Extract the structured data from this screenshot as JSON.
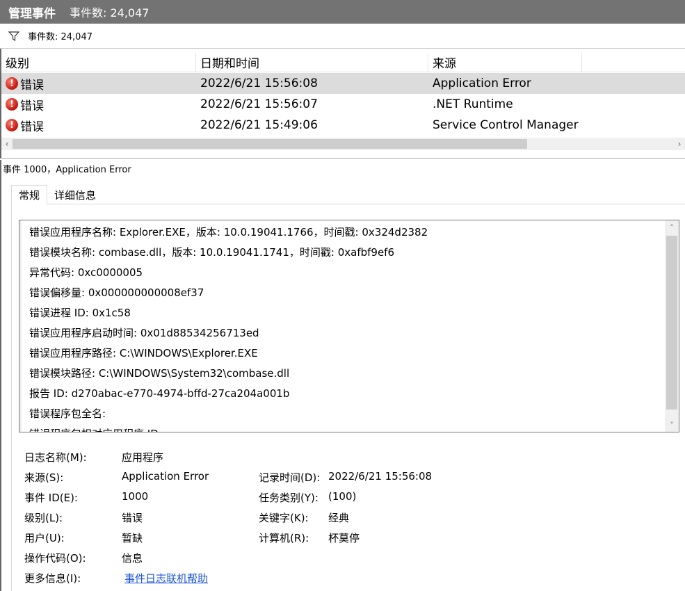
{
  "title": {
    "main": "管理事件",
    "count": "事件数: 24,047"
  },
  "filter": {
    "icon": "filter-icon",
    "text": "事件数: 24,047"
  },
  "list": {
    "columns": {
      "level": "级别",
      "datetime": "日期和时间",
      "source": "来源"
    },
    "rows": [
      {
        "level": "错误",
        "datetime": "2022/6/21 15:56:08",
        "source": "Application Error",
        "selected": true
      },
      {
        "level": "错误",
        "datetime": "2022/6/21 15:56:07",
        "source": ".NET Runtime",
        "selected": false
      },
      {
        "level": "错误",
        "datetime": "2022/6/21 15:49:06",
        "source": "Service Control Manager",
        "selected": false
      }
    ],
    "scroll_left": "‹",
    "scroll_right": "›"
  },
  "detail": {
    "header": "事件 1000，Application Error",
    "tabs": {
      "general": "常规",
      "details": "详细信息"
    },
    "description": [
      "错误应用程序名称: Explorer.EXE，版本: 10.0.19041.1766，时间戳: 0x324d2382",
      "错误模块名称: combase.dll，版本: 10.0.19041.1741，时间戳: 0xafbf9ef6",
      "异常代码: 0xc0000005",
      "错误偏移量: 0x000000000008ef37",
      "错误进程 ID: 0x1c58",
      "错误应用程序启动时间: 0x01d88534256713ed",
      "错误应用程序路径: C:\\WINDOWS\\Explorer.EXE",
      "错误模块路径: C:\\WINDOWS\\System32\\combase.dll",
      "报告 ID: d270abac-e770-4974-bffd-27ca204a001b",
      "错误程序包全名:",
      "错误程序包相对应用程序 ID:"
    ],
    "scroll_up": "˄",
    "scroll_down": "˅",
    "props": {
      "log_name_label": "日志名称(M):",
      "log_name_value": "应用程序",
      "source_label": "来源(S):",
      "source_value": "Application Error",
      "logged_label": "记录时间(D):",
      "logged_value": "2022/6/21 15:56:08",
      "event_id_label": "事件 ID(E):",
      "event_id_value": "1000",
      "task_label": "任务类别(Y):",
      "task_value": "(100)",
      "level_label": "级别(L):",
      "level_value": "错误",
      "keywords_label": "关键字(K):",
      "keywords_value": "经典",
      "user_label": "用户(U):",
      "user_value": "暂缺",
      "computer_label": "计算机(R):",
      "computer_value": "杯莫停",
      "opcode_label": "操作代码(O):",
      "opcode_value": "信息",
      "more_label": "更多信息(I):",
      "more_link": "事件日志联机帮助"
    }
  }
}
